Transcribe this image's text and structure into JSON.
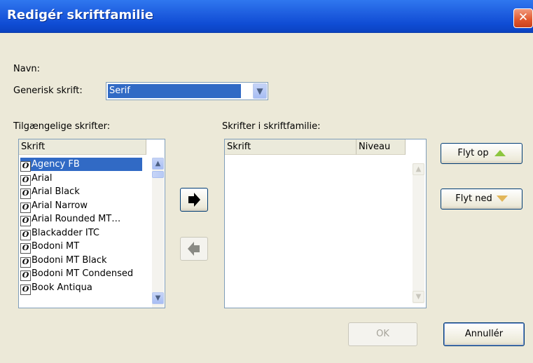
{
  "window": {
    "title": "Redigér skriftfamilie"
  },
  "labels": {
    "name": "Navn:",
    "generic_font": "Generisk skrift:",
    "available_fonts": "Tilgængelige skrifter:",
    "family_fonts": "Skrifter i skriftfamilie:"
  },
  "generic_font": {
    "selected": "Serif"
  },
  "available_list": {
    "header": "Skrift",
    "items": [
      "Agency FB",
      "Arial",
      "Arial Black",
      "Arial Narrow",
      "Arial Rounded MT…",
      "Blackadder ITC",
      "Bodoni MT",
      "Bodoni MT Black",
      "Bodoni MT Condensed",
      "Book Antiqua"
    ],
    "selected": "Agency FB"
  },
  "family_list": {
    "header_font": "Skrift",
    "header_level": "Niveau"
  },
  "buttons": {
    "move_up": "Flyt op",
    "move_down": "Flyt ned",
    "ok": "OK",
    "cancel": "Annullér",
    "close": "✕"
  },
  "colors": {
    "titlebar": "#0f4cd4",
    "selection": "#316ac5",
    "dialog_bg": "#ece9d8"
  }
}
